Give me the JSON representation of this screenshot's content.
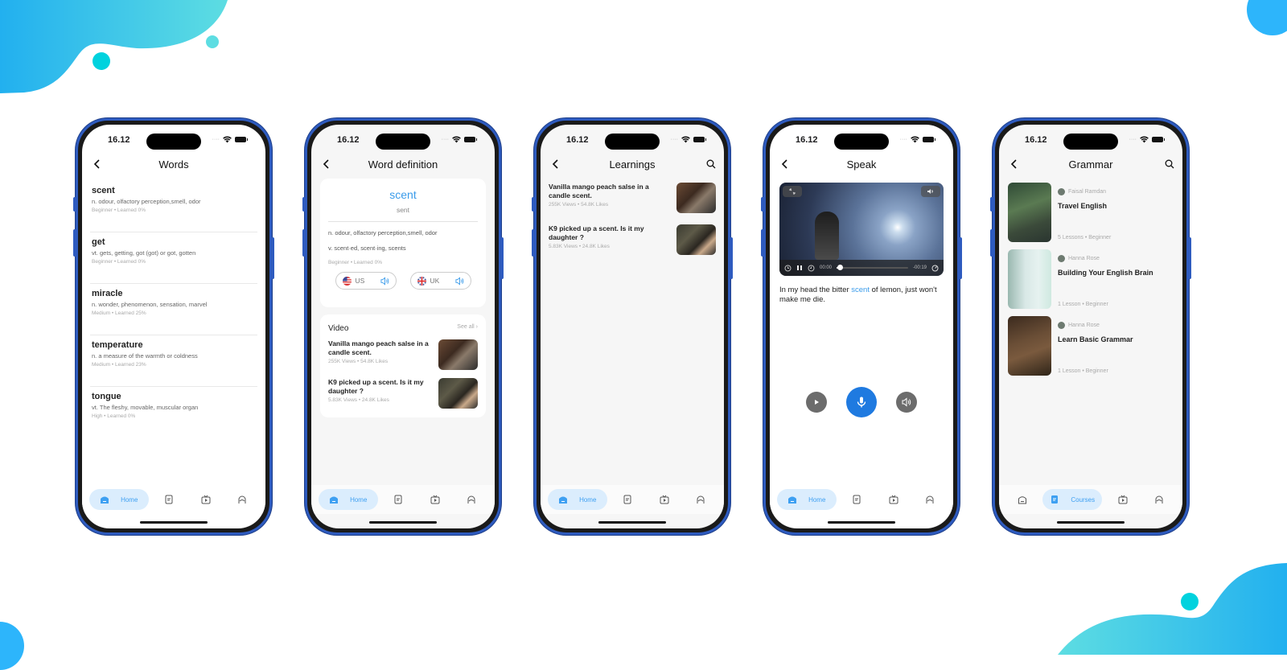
{
  "status": {
    "time": "16.12"
  },
  "colors": {
    "accent": "#3a9bea",
    "mic": "#1f7ae0",
    "frame": "#2e5bbf",
    "tab_active_bg": "#dbedfd"
  },
  "words_screen": {
    "title": "Words",
    "items": [
      {
        "word": "scent",
        "definition": "n. odour, olfactory perception,smell, odor",
        "level": "Beginner",
        "learned": "Learned 0%"
      },
      {
        "word": "get",
        "definition": "vt. gets, getting, got (got) or got, gotten",
        "level": "Beginner",
        "learned": "Learned 0%"
      },
      {
        "word": "miracle",
        "definition": "n. wonder, phenomenon, sensation, marvel",
        "level": "Medium",
        "learned": "Learned 25%"
      },
      {
        "word": "temperature",
        "definition": "n. a measure of the warmth or coldness",
        "level": "Medium",
        "learned": "Learned 23%"
      },
      {
        "word": "tongue",
        "definition": "vt. The fleshy, movable, muscular organ",
        "level": "High",
        "learned": "Learned 0%"
      }
    ],
    "tabbar": {
      "active_label": "Home"
    }
  },
  "definition_screen": {
    "title": "Word definition",
    "word": "scent",
    "phonetic": "sent",
    "noun_line": "n. odour, olfactory perception,smell, odor",
    "verb_line": "v. scent·ed, scent·ing, scents",
    "level": "Beginner",
    "learned": "Learned 0%",
    "pronunciations": [
      {
        "label": "US",
        "icon": "us-flag-icon"
      },
      {
        "label": "UK",
        "icon": "uk-flag-icon"
      }
    ],
    "video_section": {
      "title": "Video",
      "see_all": "See all",
      "items": [
        {
          "title": "Vanilla mango peach salse in a candle scent.",
          "views": "255K Views",
          "likes": "54.8K Likes"
        },
        {
          "title": "K9 picked up a scent. Is it my daughter ?",
          "views": "5.83K Views",
          "likes": "24.8K Likes"
        }
      ]
    },
    "tabbar": {
      "active_label": "Home"
    }
  },
  "learnings_screen": {
    "title": "Learnings",
    "items": [
      {
        "title": "Vanilla mango peach salse in a candle scent.",
        "views": "255K Views",
        "likes": "54.8K Likes"
      },
      {
        "title": "K9 picked up a scent. Is it my daughter ?",
        "views": "5.83K Views",
        "likes": "24.8K Likes"
      }
    ],
    "tabbar": {
      "active_label": "Home"
    }
  },
  "speak_screen": {
    "title": "Speak",
    "video": {
      "current_time": "00:00",
      "remaining_time": "-00:19",
      "progress": 0.05
    },
    "sentence_before": "In my head the bitter ",
    "sentence_highlight": "scent",
    "sentence_after": " of lemon, just won't make me die.",
    "tabbar": {
      "active_label": "Home"
    }
  },
  "grammar_screen": {
    "title": "Grammar",
    "courses": [
      {
        "author": "Faisal Ramdan",
        "title": "Travel English",
        "lessons": "5 Lessons",
        "level": "Beginner"
      },
      {
        "author": "Hanna Rose",
        "title": "Building Your English Brain",
        "lessons": "1 Lesson",
        "level": "Beginner"
      },
      {
        "author": "Hanna Rose",
        "title": "Learn Basic Grammar",
        "lessons": "1 Lesson",
        "level": "Beginner"
      }
    ],
    "tabbar": {
      "active_label": "Courses"
    }
  }
}
